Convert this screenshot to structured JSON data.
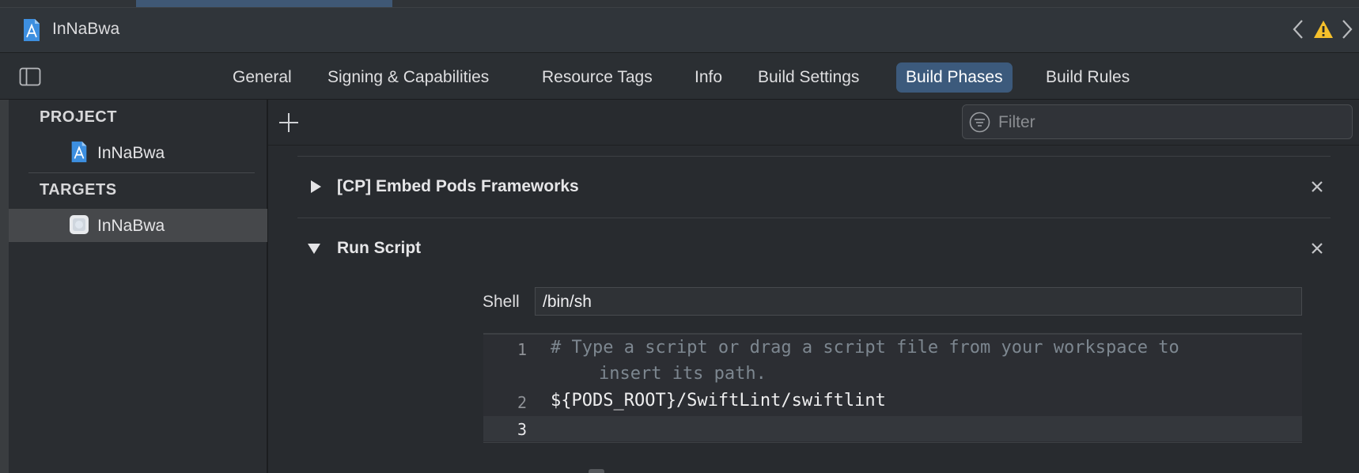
{
  "window": {
    "title": "InNaBwa"
  },
  "tabs": [
    {
      "label": "General",
      "active": false
    },
    {
      "label": "Signing & Capabilities",
      "active": false
    },
    {
      "label": "Resource Tags",
      "active": false
    },
    {
      "label": "Info",
      "active": false
    },
    {
      "label": "Build Settings",
      "active": false
    },
    {
      "label": "Build Phases",
      "active": true
    },
    {
      "label": "Build Rules",
      "active": false
    }
  ],
  "sidebar": {
    "project_header": "PROJECT",
    "project_item": "InNaBwa",
    "targets_header": "TARGETS",
    "target_item": "InNaBwa"
  },
  "filter": {
    "placeholder": "Filter"
  },
  "phases": [
    {
      "title": "[CP] Embed Pods Frameworks",
      "expanded": false
    },
    {
      "title": "Run Script",
      "expanded": true
    }
  ],
  "run_script": {
    "shell_label": "Shell",
    "shell_value": "/bin/sh",
    "lines": [
      {
        "number": "1",
        "text": "# Type a script or drag a script file from your workspace to",
        "cont": "    insert its path.",
        "kind": "comment"
      },
      {
        "number": "2",
        "text": "${PODS_ROOT}/SwiftLint/swiftlint",
        "kind": "plain"
      },
      {
        "number": "3",
        "text": "",
        "kind": "plain"
      }
    ]
  },
  "colors": {
    "accent_tab": "#3c5a7c",
    "warning": "#f5c02b",
    "app_icon": "#3d8fe0"
  },
  "icons": [
    "xcode-project-icon",
    "warning-icon",
    "chevron-left-icon",
    "chevron-right-icon",
    "sidebar-toggle-icon",
    "plus-icon",
    "filter-icon",
    "disclosure-triangle-icon",
    "close-icon",
    "app-target-icon"
  ]
}
